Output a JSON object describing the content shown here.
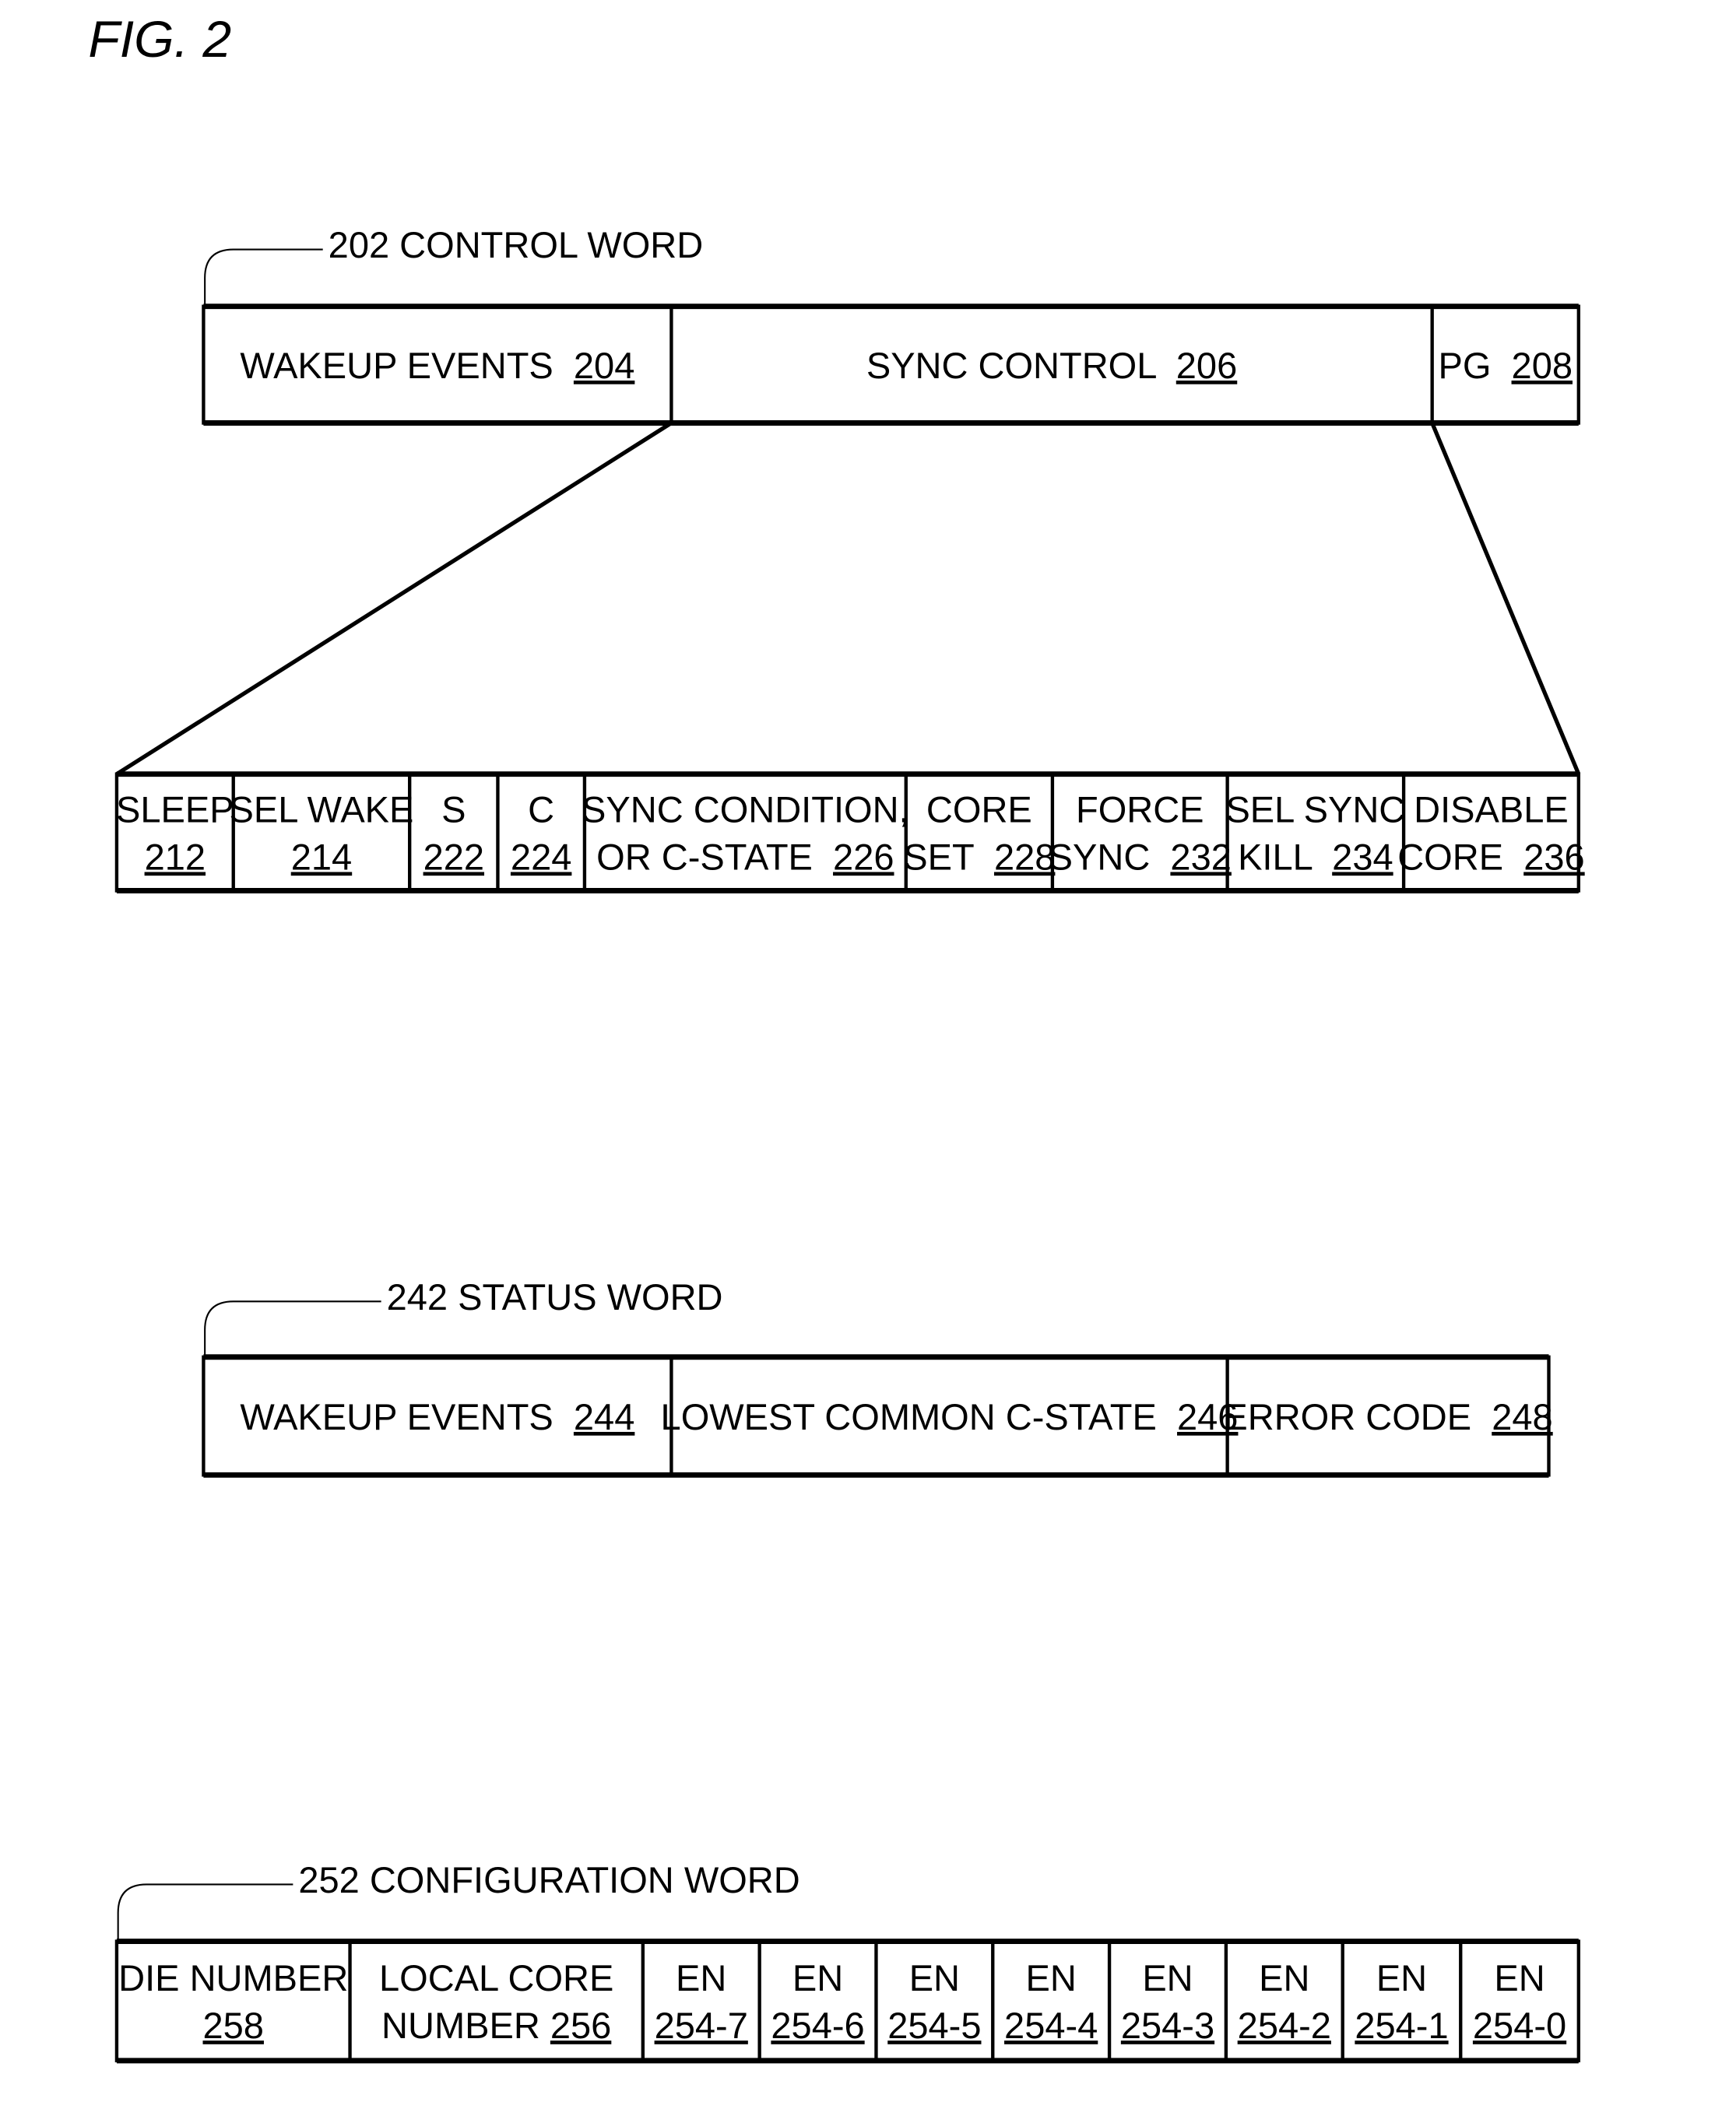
{
  "figure_title": "FIG. 2",
  "control_word": {
    "label": "202 CONTROL WORD",
    "fields": [
      {
        "lines": [
          [
            "WAKEUP EVENTS  ",
            "204"
          ]
        ]
      },
      {
        "lines": [
          [
            "SYNC CONTROL  ",
            "206"
          ]
        ]
      },
      {
        "lines": [
          [
            "PG  ",
            "208"
          ]
        ]
      }
    ]
  },
  "sync_control_expansion": {
    "fields": [
      {
        "lines": [
          [
            "SLEEP",
            ""
          ],
          [
            "",
            "212"
          ]
        ]
      },
      {
        "lines": [
          [
            "SEL WAKE",
            ""
          ],
          [
            "",
            "214"
          ]
        ]
      },
      {
        "lines": [
          [
            "S",
            ""
          ],
          [
            "",
            "222"
          ]
        ]
      },
      {
        "lines": [
          [
            "C",
            ""
          ],
          [
            "",
            "224"
          ]
        ]
      },
      {
        "lines": [
          [
            "SYNC CONDITION,",
            ""
          ],
          [
            "OR C-STATE  ",
            "226"
          ]
        ]
      },
      {
        "lines": [
          [
            "CORE",
            ""
          ],
          [
            "SET  ",
            "228"
          ]
        ]
      },
      {
        "lines": [
          [
            "FORCE",
            ""
          ],
          [
            "SYNC  ",
            "232"
          ]
        ]
      },
      {
        "lines": [
          [
            "SEL SYNC",
            ""
          ],
          [
            "KILL  ",
            "234"
          ]
        ]
      },
      {
        "lines": [
          [
            "DISABLE",
            ""
          ],
          [
            "CORE  ",
            "236"
          ]
        ]
      }
    ]
  },
  "status_word": {
    "label": "242 STATUS WORD",
    "fields": [
      {
        "lines": [
          [
            "WAKEUP EVENTS  ",
            "244"
          ]
        ]
      },
      {
        "lines": [
          [
            "LOWEST COMMON C-STATE  ",
            "246"
          ]
        ]
      },
      {
        "lines": [
          [
            "ERROR CODE  ",
            "248"
          ]
        ]
      }
    ]
  },
  "configuration_word": {
    "label": "252 CONFIGURATION WORD",
    "fields": [
      {
        "lines": [
          [
            "DIE NUMBER",
            ""
          ],
          [
            "",
            "258"
          ]
        ]
      },
      {
        "lines": [
          [
            "LOCAL CORE",
            ""
          ],
          [
            "NUMBER ",
            "256"
          ]
        ]
      },
      {
        "lines": [
          [
            "EN",
            ""
          ],
          [
            "",
            "254-7"
          ]
        ]
      },
      {
        "lines": [
          [
            "EN",
            ""
          ],
          [
            "",
            "254-6"
          ]
        ]
      },
      {
        "lines": [
          [
            "EN",
            ""
          ],
          [
            "",
            "254-5"
          ]
        ]
      },
      {
        "lines": [
          [
            "EN",
            ""
          ],
          [
            "",
            "254-4"
          ]
        ]
      },
      {
        "lines": [
          [
            "EN",
            ""
          ],
          [
            "",
            "254-3"
          ]
        ]
      },
      {
        "lines": [
          [
            "EN",
            ""
          ],
          [
            "",
            "254-2"
          ]
        ]
      },
      {
        "lines": [
          [
            "EN",
            ""
          ],
          [
            "",
            "254-1"
          ]
        ]
      },
      {
        "lines": [
          [
            "EN",
            ""
          ],
          [
            "",
            "254-0"
          ]
        ]
      }
    ]
  }
}
